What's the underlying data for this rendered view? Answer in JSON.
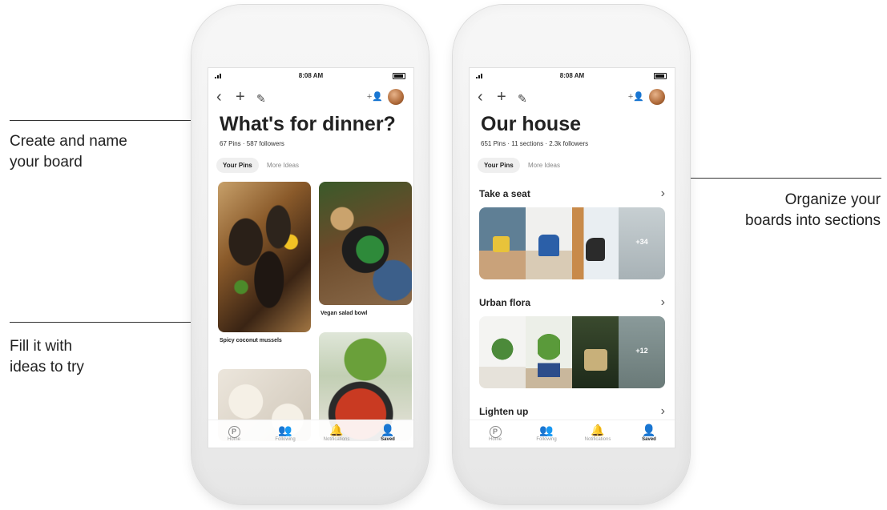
{
  "callouts": {
    "create_line1": "Create and name",
    "create_line2": "your board",
    "fill_line1": "Fill it with",
    "fill_line2": "ideas to try",
    "organize_line1": "Organize your",
    "organize_line2": "boards into sections"
  },
  "left_phone": {
    "status_time": "8:08 AM",
    "board_title": "What's for dinner?",
    "board_meta": "67 Pins · 587 followers",
    "tabs": [
      "Your Pins",
      "More Ideas"
    ],
    "pins": [
      {
        "label": "Spicy coconut mussels"
      },
      {
        "label": "Vegan salad bowl"
      },
      {
        "label": ""
      },
      {
        "label": ""
      }
    ],
    "nav": [
      "Home",
      "Following",
      "Notifications",
      "Saved"
    ]
  },
  "right_phone": {
    "status_time": "8:08 AM",
    "board_title": "Our house",
    "board_meta": "651 Pins · 11 sections · 2.3k followers",
    "tabs": [
      "Your Pins",
      "More Ideas"
    ],
    "sections": [
      {
        "name": "Take a seat",
        "more_count": "+34"
      },
      {
        "name": "Urban flora",
        "more_count": "+12"
      },
      {
        "name": "Lighten up",
        "more_count": ""
      }
    ],
    "nav": [
      "Home",
      "Following",
      "Notifications",
      "Saved"
    ]
  },
  "icons": {
    "back": "back-icon",
    "add": "plus-icon",
    "edit": "pencil-icon",
    "collaborator": "add-collaborator-icon",
    "chevron": "chevron-right-icon"
  },
  "colors": {
    "text": "#222222",
    "tab_active_bg": "#efefef"
  }
}
